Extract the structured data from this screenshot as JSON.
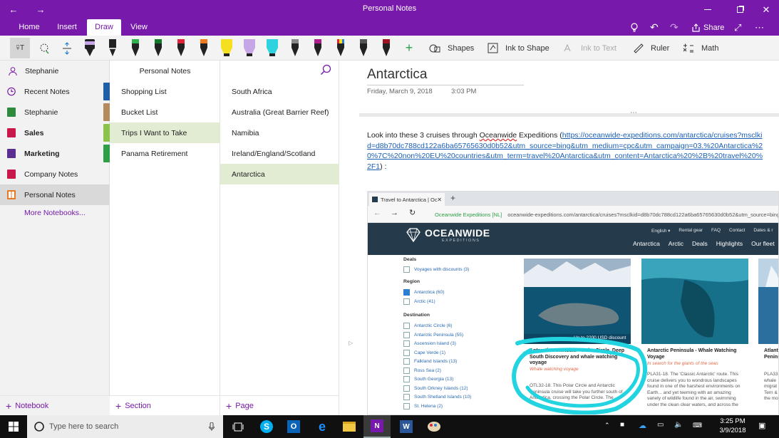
{
  "window": {
    "title": "Personal Notes"
  },
  "ribbon": {
    "tabs": [
      "Home",
      "Insert",
      "Draw",
      "View"
    ],
    "active_tab": "Draw",
    "share_label": "Share"
  },
  "toolbar": {
    "shapes_label": "Shapes",
    "ink_to_shape_label": "Ink to Shape",
    "ink_to_text_label": "Ink to Text",
    "ruler_label": "Ruler",
    "math_label": "Math"
  },
  "user": {
    "name": "Stephanie"
  },
  "notebooks": [
    {
      "label": "Recent Notes",
      "color": "#7719aa",
      "bold": false
    },
    {
      "label": "Stephanie",
      "color": "#2e8b3d",
      "bold": false
    },
    {
      "label": "Sales",
      "color": "#c8174a",
      "bold": true
    },
    {
      "label": "Marketing",
      "color": "#5b2e91",
      "bold": true
    },
    {
      "label": "Company Notes",
      "color": "#c8174a",
      "bold": false
    },
    {
      "label": "Personal Notes",
      "color": "#e87722",
      "bold": false
    }
  ],
  "more_notebooks": "More Notebooks...",
  "sections_header": "Personal Notes",
  "sections": [
    {
      "label": "Shopping List",
      "color": "#1f5fa8"
    },
    {
      "label": "Bucket List",
      "color": "#b58a5f"
    },
    {
      "label": "Trips I Want to Take",
      "color": "#8bc34a"
    },
    {
      "label": "Panama Retirement",
      "color": "#2e9e47"
    }
  ],
  "pages": [
    "South Africa",
    "Australia (Great Barrier Reef)",
    "Namibia",
    "Ireland/England/Scotland",
    "Antarctica"
  ],
  "add": {
    "notebook": "Notebook",
    "section": "Section",
    "page": "Page"
  },
  "note": {
    "title": "Antarctica",
    "date": "Friday, March 9, 2018",
    "time": "3:03 PM",
    "intro_before": "Look into these 3 cruises through ",
    "oceanwide": "Oceanwide",
    "intro_after": " Expeditions (",
    "link": "https://oceanwide-expeditions.com/antarctica/cruises?msclkid=d8b70dc788cd122a6ba65765630d0b52&utm_source=bing&utm_medium=cpc&utm_campaign=03.%20Antarctica%20%7C%20non%20EU%20countries&utm_term=travel%20Antarctica&utm_content=Antarctica%20%2B%20travel%20%2F1",
    "closing": ") :"
  },
  "screenshot": {
    "tab_title": "Travel to Antarctica | Oc",
    "site_badge": "Oceanwide Expeditions [NL]",
    "url": "oceanwide-expeditions.com/antarctica/cruises?msclkid=d8b70dc788cd122a6ba65765630d0b52&utm_source=bing&utm_medium=cpc",
    "brand": "OCEANWIDE",
    "brand_sub": "EXPEDITIONS",
    "top_links": [
      "English ▾",
      "Rental gear",
      "FAQ",
      "Contact",
      "Dates & r"
    ],
    "nav": [
      "Antarctica",
      "Arctic",
      "Deals",
      "Highlights",
      "Our fleet"
    ],
    "filter_deals": "Deals",
    "deal_item": "Voyages with discounts (3)",
    "filter_region": "Region",
    "regions": [
      {
        "label": "Antarctica (60)",
        "checked": true
      },
      {
        "label": "Arctic (41)",
        "checked": false
      }
    ],
    "filter_destination": "Destination",
    "destinations": [
      "Antarctic Circle (6)",
      "Antarctic Peninsula (55)",
      "Ascension Island (3)",
      "Cape Verde (1)",
      "Falkland Islands (13)",
      "Ross Sea (2)",
      "South Georgia (13)",
      "South Orkney Islands (12)",
      "South Shetland Islands (10)",
      "St. Helena (2)"
    ],
    "cards": [
      {
        "discount": "Up to 2200 USD discount",
        "title": "Antarctic Peninsula – Polar Circle, Deep South Discovery and whale watching voyage",
        "subtitle": "Whale watching voyage",
        "desc": "OTL32-18. This Polar Circle and Antarctic Peninsula cruise will take you further south of Antarctica, crossing the Polar Circle. The"
      },
      {
        "title": "Antarctic Peninsula - Whale Watching Voyage",
        "subtitle": "In search for the giants of the seas",
        "desc": "PLA31-18. The 'Classic Antarctic' route. This cruise delivers you to wondrous landscapes found in one of the harshest environments on Earth... and yet teeming with an amazing variety of wildlife found in the air, swimming under the clean clear waters, and across the"
      },
      {
        "title": "Atlant Penins",
        "desc": "PLA33 whale migrat Tern & the mo"
      }
    ]
  },
  "taskbar": {
    "search_placeholder": "Type here to search",
    "time": "3:25 PM",
    "date": "3/9/2018"
  }
}
